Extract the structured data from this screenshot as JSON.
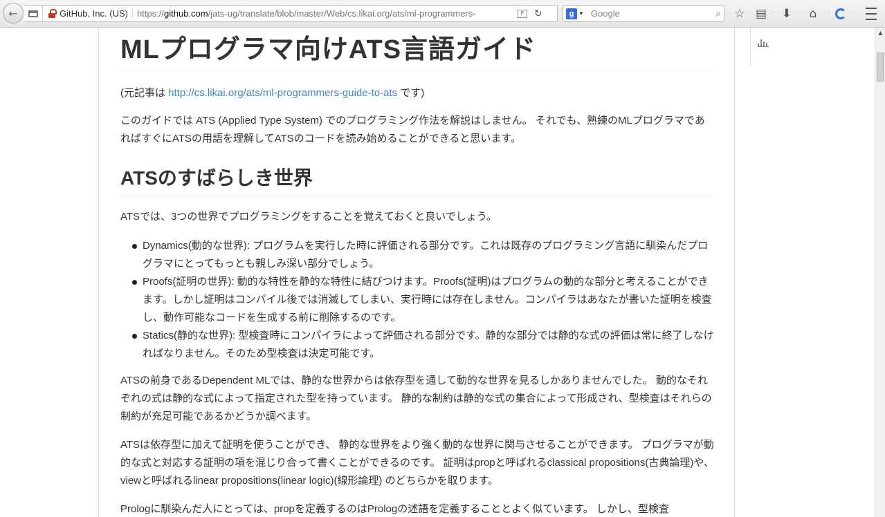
{
  "browser": {
    "identity": "GitHub, Inc. (US)",
    "url_prefix": "https://",
    "url_domain": "github.com",
    "url_path": "/jats-ug/translate/blob/master/Web/cs.likai.org/ats/ml-programmers-",
    "search_placeholder": "Google",
    "search_engine_letter": "g"
  },
  "article": {
    "title": "MLプログラマ向けATS言語ガイド",
    "source_prefix": "(元記事は ",
    "source_link": "http://cs.likai.org/ats/ml-programmers-guide-to-ats",
    "source_suffix": " です)",
    "intro": "このガイドでは ATS (Applied Type System) でのプログラミング作法を解説はしません。 それでも、熟練のMLプログラマであればすぐにATSの用語を理解してATSのコードを読み始めることができると思います。",
    "section_title": "ATSのすばらしき世界",
    "section_intro": "ATSでは、3つの世界でプログラミングをすることを覚えておくと良いでしょう。",
    "worlds": [
      "Dynamics(動的な世界): プログラムを実行した時に評価される部分です。これは既存のプログラミング言語に馴染んだプログラマにとってもっとも親しみ深い部分でしょう。",
      "Proofs(証明の世界): 動的な特性を静的な特性に結びつけます。Proofs(証明)はプログラムの動的な部分と考えることができます。しかし証明はコンパイル後では消滅してしまい、実行時には存在しません。コンパイラはあなたが書いた証明を検査し、動作可能なコードを生成する前に削除するのです。",
      "Statics(静的な世界): 型検査時にコンパイラによって評価される部分です。静的な部分では静的な式の評価は常に終了しなければなりません。そのため型検査は決定可能です。"
    ],
    "para_dependent_ml": "ATSの前身であるDependent MLでは、静的な世界からは依存型を通して動的な世界を見るしかありませんでした。 動的なそれぞれの式は静的な式によって指定された型を持っています。 静的な制約は静的な式の集合によって形成され、型検査はそれらの制約が充足可能であるかどうか調べます。",
    "para_proofs": "ATSは依存型に加えて証明を使うことができ、 静的な世界をより強く動的な世界に関与させることができます。 プログラマが動的な式と対応する証明の項を混じり合って書くことができるのです。 証明はpropと呼ばれるclassical propositions(古典論理)や、 viewと呼ばれるlinear propositions(linear logic)(線形論理) のどちらかを取ります。",
    "para_prolog": "Prologに馴染んだ人にとっては、propを定義するのはPrologの述語を定義することとよく似ています。 しかし、型検査"
  }
}
